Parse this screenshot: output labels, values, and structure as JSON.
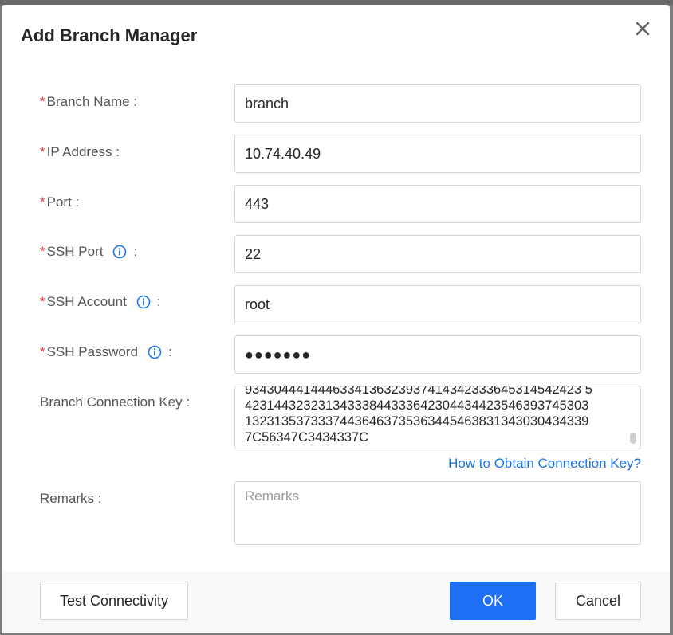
{
  "dialog": {
    "title": "Add Branch Manager",
    "close_icon": "close-icon"
  },
  "form": {
    "branch_name": {
      "label": "Branch Name :",
      "value": "branch",
      "required": true
    },
    "ip_address": {
      "label": "IP Address :",
      "value": "10.74.40.49",
      "required": true
    },
    "port": {
      "label": "Port :",
      "value": "443",
      "required": true
    },
    "ssh_port": {
      "label": "SSH Port",
      "suffix": ":",
      "value": "22",
      "required": true,
      "icon": "info-icon"
    },
    "ssh_account": {
      "label": "SSH Account",
      "suffix": ":",
      "value": "root",
      "required": true,
      "icon": "info-icon"
    },
    "ssh_password": {
      "label": "SSH Password",
      "suffix": ":",
      "value": "●●●●●●●",
      "required": true,
      "icon": "info-icon"
    },
    "connection_key": {
      "label": "Branch Connection Key :",
      "value": "93430444144463341363239374143423336453145424235423144323231343338443336423044344235463937453031323135373337443646373536344546383134303043433397C56347C3434337C",
      "lines": [
        "9343044414446334136323937414342333645314542423 5",
        "42314432323134333844333642304434423546393745303",
        "13231353733374436463735363445463831343030434339",
        "7C56347C3434337C"
      ]
    },
    "help_link": "How to Obtain Connection Key?",
    "remarks": {
      "label": "Remarks :",
      "placeholder": "Remarks",
      "value": ""
    },
    "required_marker": "*"
  },
  "footer": {
    "test_label": "Test Connectivity",
    "ok_label": "OK",
    "cancel_label": "Cancel"
  },
  "colors": {
    "accent": "#1e6ff5",
    "link": "#1a73e8",
    "required": "#e23b3b"
  }
}
